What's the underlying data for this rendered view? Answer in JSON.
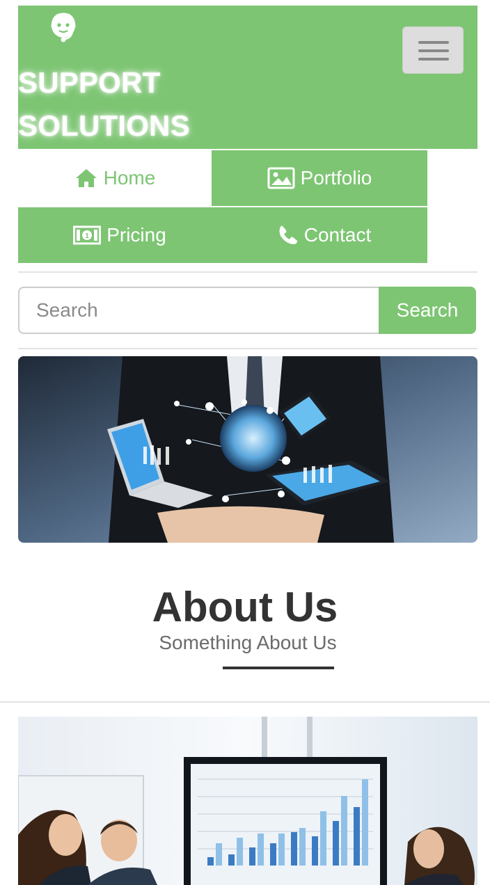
{
  "header": {
    "brand_line1": "SUPPORT",
    "brand_line2": "SOLUTIONS",
    "logo_icon": "headset-support-icon",
    "menu_toggle_icon": "hamburger-icon"
  },
  "nav": {
    "items": [
      {
        "label": "Home",
        "icon": "home-icon"
      },
      {
        "label": "Portfolio",
        "icon": "image-icon"
      },
      {
        "label": "Pricing",
        "icon": "money-icon"
      },
      {
        "label": "Contact",
        "icon": "phone-icon"
      }
    ]
  },
  "search": {
    "placeholder": "Search",
    "button_label": "Search"
  },
  "about": {
    "title": "About Us",
    "subtitle": "Something About Us"
  },
  "colors": {
    "accent": "#7dc573",
    "text_dark": "#333333",
    "text_muted": "#6b6b6b"
  }
}
